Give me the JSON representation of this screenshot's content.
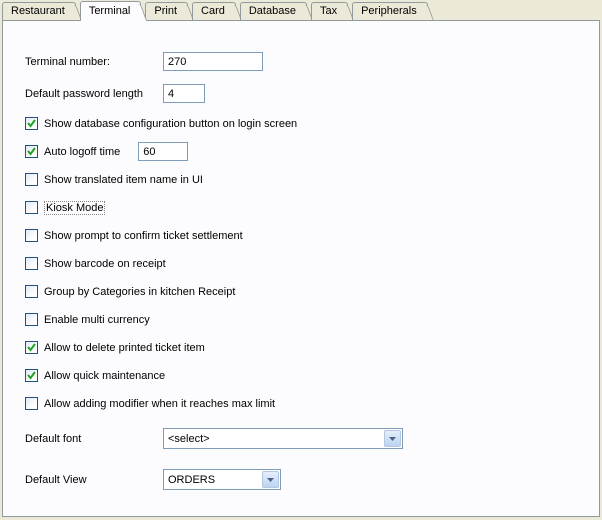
{
  "tabs": {
    "restaurant": "Restaurant",
    "terminal": "Terminal",
    "print": "Print",
    "card": "Card",
    "database": "Database",
    "tax": "Tax",
    "peripherals": "Peripherals"
  },
  "rows": {
    "terminal_number_label": "Terminal number:",
    "terminal_number_value": "270",
    "default_pw_len_label": "Default password length",
    "default_pw_len_value": "4",
    "default_font_label": "Default font",
    "default_font_value": "<select>",
    "default_view_label": "Default View",
    "default_view_value": "ORDERS"
  },
  "checks": {
    "show_db_cfg": {
      "label": "Show database configuration button on login screen",
      "checked": true
    },
    "auto_logoff": {
      "label": "Auto logoff time",
      "checked": true,
      "value": "60"
    },
    "show_translated": {
      "label": "Show translated item name in UI",
      "checked": false
    },
    "kiosk_mode": {
      "label": "Kiosk Mode",
      "checked": false
    },
    "confirm_settlement": {
      "label": "Show prompt to confirm ticket settlement",
      "checked": false
    },
    "barcode_receipt": {
      "label": "Show barcode on receipt",
      "checked": false
    },
    "group_categories": {
      "label": "Group by Categories in kitchen Receipt",
      "checked": false
    },
    "multi_currency": {
      "label": "Enable multi currency",
      "checked": false
    },
    "delete_printed": {
      "label": "Allow to delete printed ticket item",
      "checked": true
    },
    "quick_maint": {
      "label": "Allow quick maintenance",
      "checked": true
    },
    "add_mod_max": {
      "label": "Allow adding modifier when it reaches max limit",
      "checked": false
    }
  }
}
